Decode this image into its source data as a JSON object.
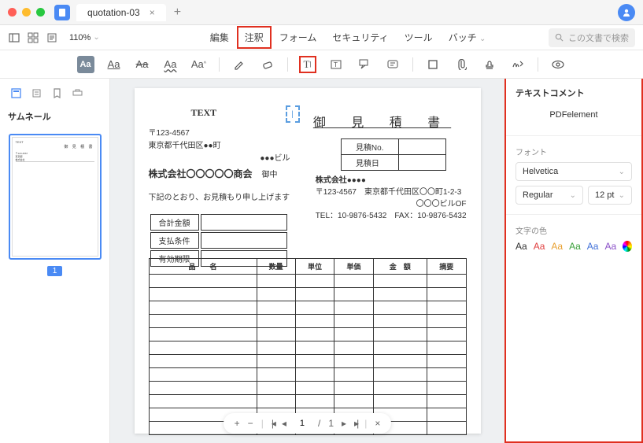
{
  "titlebar": {
    "tab_name": "quotation-03"
  },
  "menubar": {
    "zoom": "110%",
    "items": [
      "編集",
      "注釈",
      "フォーム",
      "セキュリティ",
      "ツール",
      "バッチ"
    ],
    "active_index": 1,
    "search_placeholder": "この文書で検索"
  },
  "toolbar": {
    "text_styles": [
      "Aa",
      "Aa",
      "Aa",
      "Aa",
      "Aa"
    ],
    "highlighted_tool_index": 2
  },
  "sidebar": {
    "title": "サムネール",
    "page_number": "1"
  },
  "document": {
    "text_label": "TEXT",
    "title": "御 見 積 書",
    "from": {
      "postal": "〒123-4567",
      "address": "東京都千代田区●●町",
      "building": "●●●ビル",
      "company": "株式会社〇〇〇〇〇商会",
      "attn": "御中"
    },
    "quote_rows": [
      "見積No.",
      "見積日"
    ],
    "to": {
      "company": "株式会社●●●●",
      "postal": "〒123-4567",
      "address": "東京都千代田区〇〇町1-2-3",
      "building": "〇〇〇ビルOF",
      "tel": "TEL：10-9876-5432",
      "fax": "FAX：10-9876-5432"
    },
    "intro": "下記のとおり、お見積もり申し上げます",
    "total_rows": [
      "合計金額",
      "支払条件",
      "有効期限"
    ],
    "columns": [
      "品　　名",
      "数量",
      "単位",
      "単価",
      "金　額",
      "摘要"
    ]
  },
  "pager": {
    "current": "1",
    "total": "1"
  },
  "panel": {
    "title": "テキストコメント",
    "brand": "PDFelement",
    "font_label": "フォント",
    "font_family": "Helvetica",
    "font_weight": "Regular",
    "font_size": "12 pt",
    "color_label": "文字の色",
    "colors": [
      "#333333",
      "#e04040",
      "#e8a030",
      "#3aa03a",
      "#4070d8",
      "#8a50c8"
    ]
  }
}
